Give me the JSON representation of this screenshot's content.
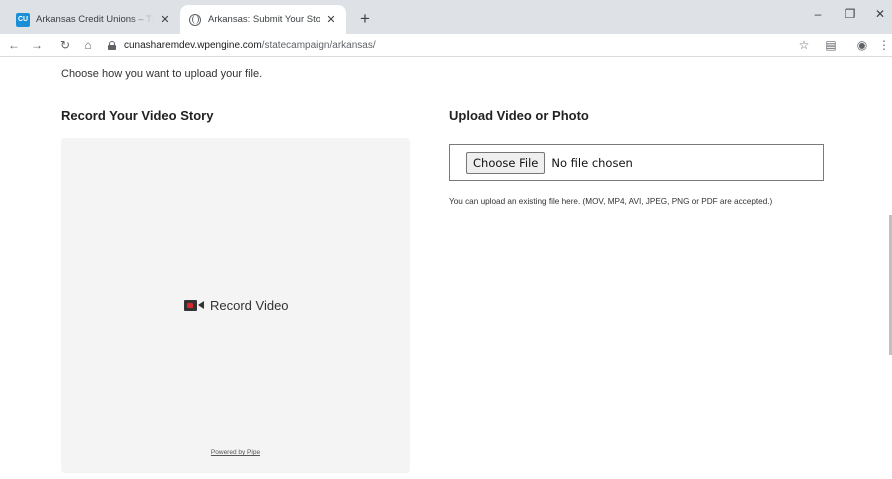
{
  "browser": {
    "tabs": [
      {
        "title": "Arkansas Credit Unions – The Ri",
        "favicon": "credit-union-logo",
        "active": false
      },
      {
        "title": "Arkansas: Submit Your Story – Cr",
        "favicon": "globe-icon",
        "active": true
      }
    ],
    "new_tab": "+",
    "window_controls": {
      "minimize": "–",
      "restore": "❐",
      "close": "✕"
    },
    "url_host": "cunasharemdev.wpengine.com",
    "url_path": "/statecampaign/arkansas/"
  },
  "page": {
    "intro": "Choose how you want to upload your file.",
    "record_heading": "Record Your Video Story",
    "record_button": "Record Video",
    "powered_by": "Powered by Pipe",
    "upload_heading": "Upload Video or Photo",
    "choose_file": "Choose File",
    "no_file": "No file chosen",
    "help_text": "You can upload an existing file here. (MOV, MP4, AVI, JPEG, PNG or PDF are accepted.)"
  },
  "colors": {
    "tabstrip": "#dee1e6",
    "recorder_bg": "#f4f4f4",
    "record_red": "#d9262c"
  }
}
